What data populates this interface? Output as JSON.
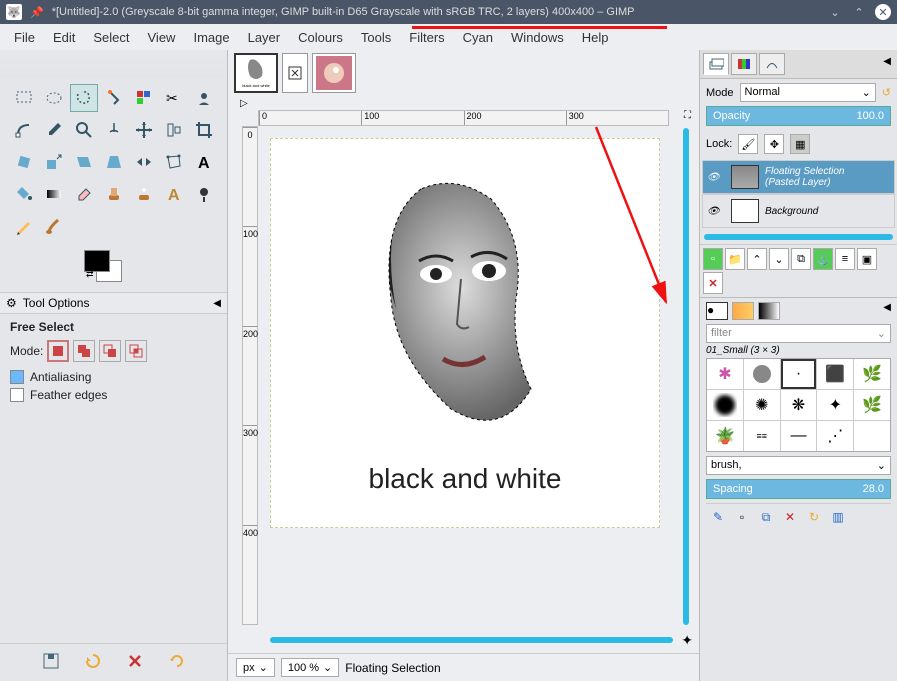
{
  "titlebar": {
    "title": "*[Untitled]-2.0 (Greyscale 8-bit gamma integer, GIMP built-in D65 Grayscale with sRGB TRC, 2 layers) 400x400 – GIMP"
  },
  "menubar": [
    "File",
    "Edit",
    "Select",
    "View",
    "Image",
    "Layer",
    "Colours",
    "Tools",
    "Filters",
    "Cyan",
    "Windows",
    "Help"
  ],
  "tool_options": {
    "panel_label": "Tool Options",
    "title": "Free Select",
    "mode_label": "Mode:",
    "antialiasing": "Antialiasing",
    "feather": "Feather edges"
  },
  "canvas": {
    "text": "black and white",
    "ruler_h": [
      "0",
      "100",
      "200",
      "300"
    ],
    "ruler_v": [
      "0",
      "100",
      "200",
      "300",
      "400"
    ]
  },
  "statusbar": {
    "unit": "px",
    "zoom": "100 %",
    "status": "Floating Selection"
  },
  "layers_panel": {
    "mode_label": "Mode",
    "mode_value": "Normal",
    "opacity_label": "Opacity",
    "opacity_value": "100.0",
    "lock_label": "Lock:",
    "layers": [
      {
        "name_line1": "Floating Selection",
        "name_line2": "(Pasted Layer)",
        "selected": true
      },
      {
        "name_line1": "Background",
        "name_line2": "",
        "selected": false
      }
    ]
  },
  "brushes": {
    "filter_placeholder": "filter",
    "current": "01_Small (3 × 3)",
    "brush_label": "brush,",
    "spacing_label": "Spacing",
    "spacing_value": "28.0"
  }
}
